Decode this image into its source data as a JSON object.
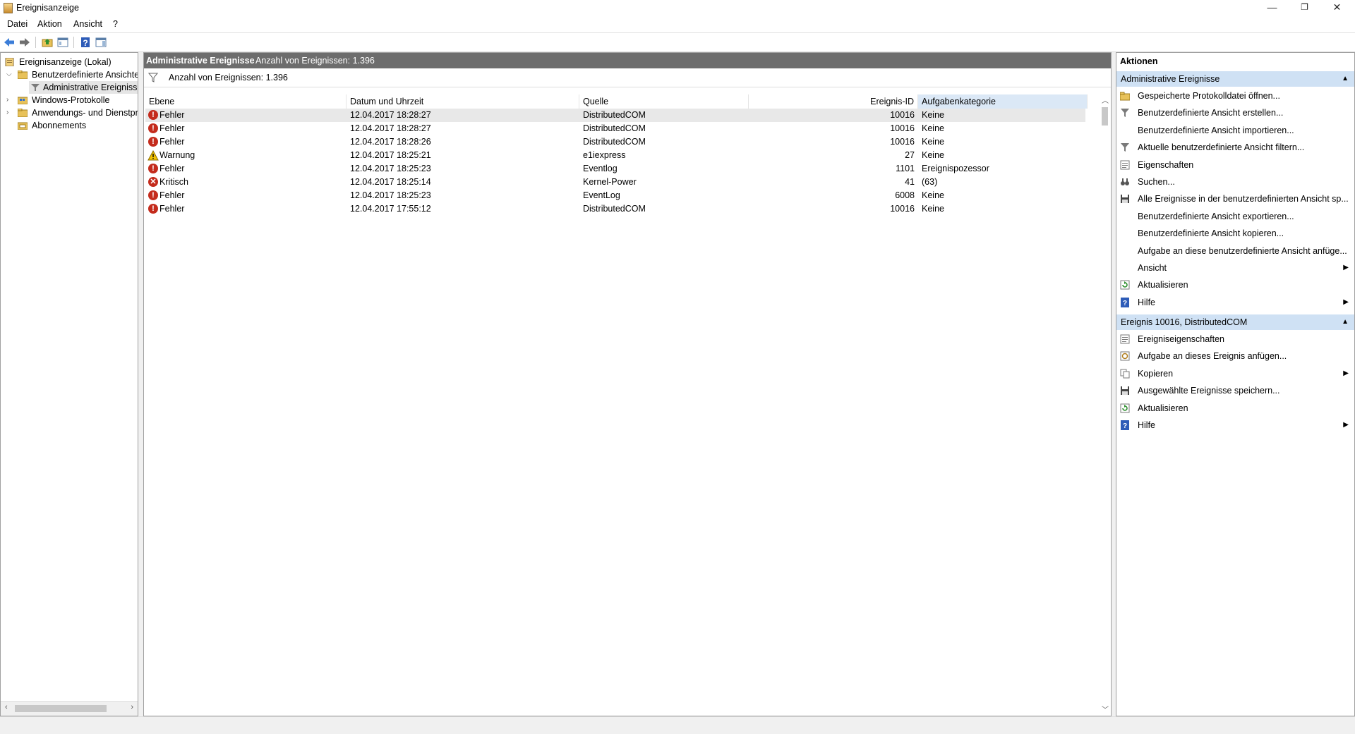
{
  "window": {
    "title": "Ereignisanzeige",
    "minimize": "—",
    "restore": "❐",
    "close": "✕"
  },
  "menu": [
    "Datei",
    "Aktion",
    "Ansicht",
    "?"
  ],
  "tree": {
    "root": "Ereignisanzeige (Lokal)",
    "custom_views": "Benutzerdefinierte Ansichten",
    "admin_events": "Administrative Ereignisse",
    "windows_logs": "Windows-Protokolle",
    "app_service_logs": "Anwendungs- und Dienstprotokolle",
    "subscriptions": "Abonnements"
  },
  "center": {
    "title": "Administrative Ereignisse",
    "count_label": "Anzahl von Ereignissen: 1.396",
    "filter_text": "Anzahl von Ereignissen: 1.396",
    "columns": [
      "Ebene",
      "Datum und Uhrzeit",
      "Quelle",
      "Ereignis-ID",
      "Aufgabenkategorie"
    ],
    "rows": [
      {
        "level": "Fehler",
        "type": "error",
        "date": "12.04.2017 18:28:27",
        "source": "DistributedCOM",
        "id": "10016",
        "category": "Keine"
      },
      {
        "level": "Fehler",
        "type": "error",
        "date": "12.04.2017 18:28:27",
        "source": "DistributedCOM",
        "id": "10016",
        "category": "Keine"
      },
      {
        "level": "Fehler",
        "type": "error",
        "date": "12.04.2017 18:28:26",
        "source": "DistributedCOM",
        "id": "10016",
        "category": "Keine"
      },
      {
        "level": "Warnung",
        "type": "warning",
        "date": "12.04.2017 18:25:21",
        "source": "e1iexpress",
        "id": "27",
        "category": "Keine"
      },
      {
        "level": "Fehler",
        "type": "error",
        "date": "12.04.2017 18:25:23",
        "source": "Eventlog",
        "id": "1101",
        "category": "Ereignispozessor"
      },
      {
        "level": "Kritisch",
        "type": "critical",
        "date": "12.04.2017 18:25:14",
        "source": "Kernel-Power",
        "id": "41",
        "category": "(63)"
      },
      {
        "level": "Fehler",
        "type": "error",
        "date": "12.04.2017 18:25:23",
        "source": "EventLog",
        "id": "6008",
        "category": "Keine"
      },
      {
        "level": "Fehler",
        "type": "error",
        "date": "12.04.2017 17:55:12",
        "source": "DistributedCOM",
        "id": "10016",
        "category": "Keine"
      }
    ]
  },
  "actions": {
    "title": "Aktionen",
    "section1": "Administrative Ereignisse",
    "items1": [
      "Gespeicherte Protokolldatei öffnen...",
      "Benutzerdefinierte Ansicht erstellen...",
      "Benutzerdefinierte Ansicht importieren...",
      "Aktuelle benutzerdefinierte Ansicht filtern...",
      "Eigenschaften",
      "Suchen...",
      "Alle Ereignisse in der benutzerdefinierten Ansicht sp...",
      "Benutzerdefinierte Ansicht exportieren...",
      "Benutzerdefinierte Ansicht kopieren...",
      "Aufgabe an diese benutzerdefinierte Ansicht anfüge...",
      "Ansicht",
      "Aktualisieren",
      "Hilfe"
    ],
    "section2": "Ereignis 10016, DistributedCOM",
    "items2": [
      "Ereigniseigenschaften",
      "Aufgabe an dieses Ereignis anfügen...",
      "Kopieren",
      "Ausgewählte Ereignisse speichern...",
      "Aktualisieren",
      "Hilfe"
    ]
  }
}
